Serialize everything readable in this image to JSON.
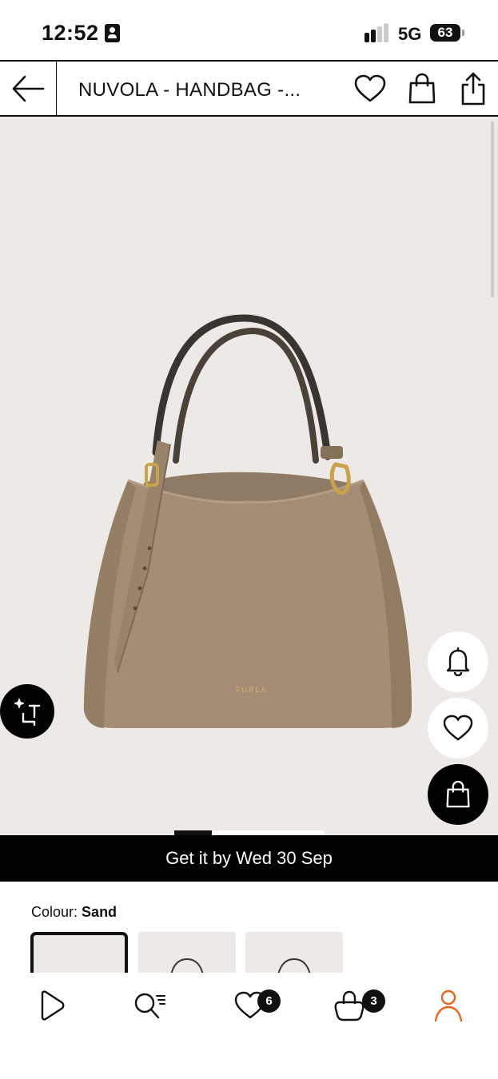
{
  "status_bar": {
    "time": "12:52",
    "network": "5G",
    "battery": "63"
  },
  "header": {
    "title": "NUVOLA - HANDBAG -...",
    "icons": [
      "back-arrow-icon",
      "heart-icon",
      "shopping-bag-icon",
      "share-icon"
    ]
  },
  "product": {
    "brand_mark": "FURLA",
    "bag_color": "#a48d74",
    "image_count_active": 1
  },
  "delivery": {
    "text": "Get it by Wed 30 Sep"
  },
  "colour": {
    "label": "Colour:",
    "value": "Sand"
  },
  "bottom_nav": {
    "items": [
      {
        "icon": "play-icon"
      },
      {
        "icon": "search-list-icon"
      },
      {
        "icon": "wishlist-heart-icon",
        "badge": "6"
      },
      {
        "icon": "cart-bag-icon",
        "badge": "3"
      },
      {
        "icon": "profile-icon",
        "active_color": "#e8641c"
      }
    ]
  },
  "colors": {
    "background": "#ece9e7",
    "accent": "#e8641c"
  }
}
